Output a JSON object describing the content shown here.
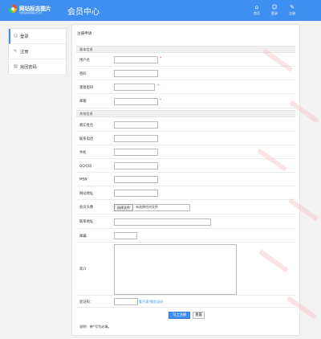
{
  "header": {
    "brand": "网站标志图片",
    "tagline": "中国领先的网站标志平台",
    "center_title": "会员中心",
    "nav": [
      {
        "label": "首页",
        "icon": "home-icon"
      },
      {
        "label": "登录",
        "icon": "user-icon"
      },
      {
        "label": "注册",
        "icon": "edit-icon"
      }
    ]
  },
  "sidebar": {
    "items": [
      {
        "label": "登录",
        "icon": "user-icon"
      },
      {
        "label": "注册",
        "icon": "pencil-icon"
      },
      {
        "label": "找回密码",
        "icon": "document-icon"
      }
    ]
  },
  "form": {
    "title": "注册申请",
    "section_basic": "基本信息",
    "section_other": "其他信息",
    "required_mark": "*",
    "fields": {
      "username": "用户名",
      "password": "密码",
      "repeat_password": "重复密码",
      "email": "邮箱",
      "real_name": "真实姓名",
      "contact_phone": "联系电话",
      "mobile": "手机",
      "qq": "QQ号码",
      "msn": "MSN",
      "website": "网站地址",
      "avatar": "会员头像",
      "address": "联系地址",
      "postcode": "邮编",
      "intro": "简介",
      "captcha": "验证码："
    },
    "file_button": "选择文件",
    "file_status": "未选择任何文件",
    "captcha_link": "看不清?换验证码",
    "submit_label": "马上注册",
    "reset_label": "重置",
    "note": "说明：带*号为必填。"
  }
}
